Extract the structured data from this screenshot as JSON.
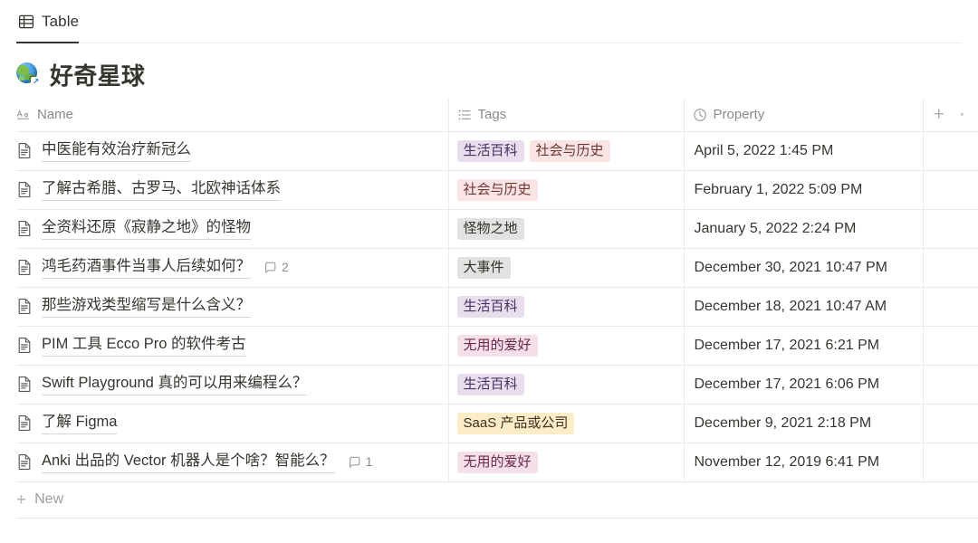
{
  "view_tab": {
    "label": "Table",
    "icon": "table-icon",
    "active": true
  },
  "page": {
    "emoji": "globe-with-arrow",
    "title": "好奇星球"
  },
  "table": {
    "columns": [
      {
        "key": "name",
        "label": "Name",
        "icon": "text-type-icon"
      },
      {
        "key": "tags",
        "label": "Tags",
        "icon": "multi-select-icon"
      },
      {
        "key": "property",
        "label": "Property",
        "icon": "clock-icon"
      }
    ],
    "header_actions": {
      "add_property_label": "+",
      "overflow_label": "⋯"
    },
    "rows": [
      {
        "icon": "page-icon",
        "name": "中医能有效治疗新冠么",
        "comments": null,
        "tags": [
          {
            "label": "生活百科",
            "color": "purple"
          },
          {
            "label": "社会与历史",
            "color": "pink"
          }
        ],
        "property": "April 5, 2022 1:45 PM"
      },
      {
        "icon": "page-icon",
        "name": "了解古希腊、古罗马、北欧神话体系",
        "comments": null,
        "tags": [
          {
            "label": "社会与历史",
            "color": "pink"
          }
        ],
        "property": "February 1, 2022 5:09 PM"
      },
      {
        "icon": "page-icon",
        "name": "全资料还原《寂静之地》的怪物",
        "comments": null,
        "tags": [
          {
            "label": "怪物之地",
            "color": "gray"
          }
        ],
        "property": "January 5, 2022 2:24 PM"
      },
      {
        "icon": "page-icon",
        "name": "鸿毛药酒事件当事人后续如何？",
        "comments": "2",
        "tags": [
          {
            "label": "大事件",
            "color": "gray"
          }
        ],
        "property": "December 30, 2021 10:47 PM"
      },
      {
        "icon": "page-icon",
        "name": "那些游戏类型缩写是什么含义？",
        "comments": null,
        "tags": [
          {
            "label": "生活百科",
            "color": "purple"
          }
        ],
        "property": "December 18, 2021 10:47 AM"
      },
      {
        "icon": "page-icon",
        "name": "PIM 工具 Ecco Pro 的软件考古",
        "comments": null,
        "tags": [
          {
            "label": "无用的爱好",
            "color": "magenta"
          }
        ],
        "property": "December 17, 2021 6:21 PM"
      },
      {
        "icon": "page-icon",
        "name": "Swift Playground 真的可以用来编程么？",
        "comments": null,
        "tags": [
          {
            "label": "生活百科",
            "color": "purple"
          }
        ],
        "property": "December 17, 2021 6:06 PM"
      },
      {
        "icon": "page-icon",
        "name": "了解 Figma",
        "comments": null,
        "tags": [
          {
            "label": "SaaS 产品或公司",
            "color": "yellow"
          }
        ],
        "property": "December 9, 2021 2:18 PM"
      },
      {
        "icon": "page-icon",
        "name": "Anki 出品的 Vector 机器人是个啥？智能么？",
        "comments": "1",
        "tags": [
          {
            "label": "无用的爱好",
            "color": "magenta"
          }
        ],
        "property": "November 12, 2019 6:41 PM"
      }
    ],
    "new_row": {
      "label": "New",
      "plus": "+"
    }
  },
  "colors": {
    "text_primary": "#37352f",
    "text_muted": "#8d8a85",
    "border": "#eceae7",
    "tag_purple_bg": "#e8deee",
    "tag_pink_bg": "#fbe4e4",
    "tag_gray_bg": "#e3e2e0",
    "tag_magenta_bg": "#f5e0e9",
    "tag_yellow_bg": "#fdecc8"
  }
}
